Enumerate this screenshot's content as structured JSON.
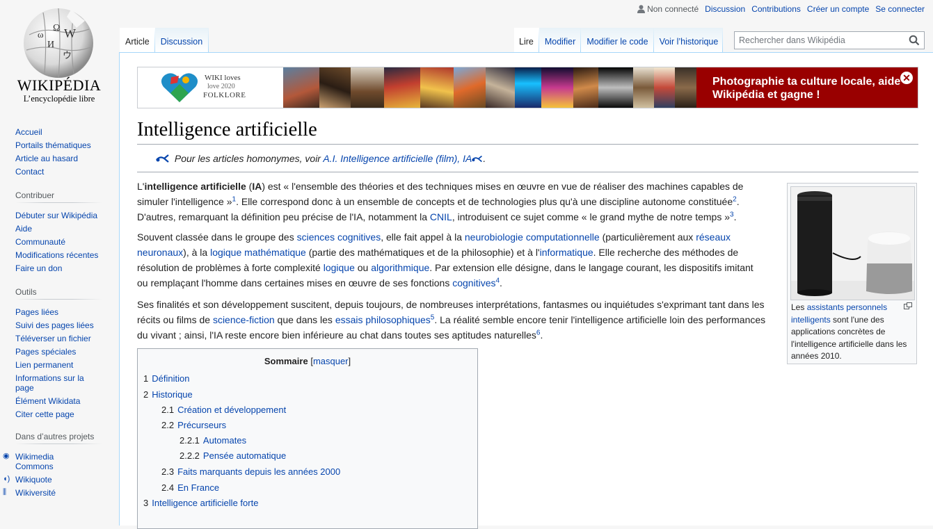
{
  "logo": {
    "wordmark": "WIKIPÉDIA",
    "tagline": "L’encyclopédie libre"
  },
  "sidebar": {
    "nav": [
      "Accueil",
      "Portails thématiques",
      "Article au hasard",
      "Contact"
    ],
    "contribute": {
      "title": "Contribuer",
      "items": [
        "Débuter sur Wikipédia",
        "Aide",
        "Communauté",
        "Modifications récentes",
        "Faire un don"
      ]
    },
    "tools": {
      "title": "Outils",
      "items": [
        "Pages liées",
        "Suivi des pages liées",
        "Téléverser un fichier",
        "Pages spéciales",
        "Lien permanent",
        "Informations sur la page",
        "Élément Wikidata",
        "Citer cette page"
      ]
    },
    "projects": {
      "title": "Dans d’autres projets",
      "items": [
        "Wikimedia Commons",
        "Wikiquote",
        "Wikiversité"
      ]
    }
  },
  "personal": {
    "status": "Non connecté",
    "links": [
      "Discussion",
      "Contributions",
      "Créer un compte",
      "Se connecter"
    ]
  },
  "tabs": {
    "left": [
      "Article",
      "Discussion"
    ],
    "right": [
      "Lire",
      "Modifier",
      "Modifier le code",
      "Voir l’historique"
    ]
  },
  "search": {
    "placeholder": "Rechercher dans Wikipédia"
  },
  "banner": {
    "wl_line1": "WIKI loves",
    "wl_line2": "love 2020",
    "wl_line3": "FOLKLORE",
    "cta_line1": "Photographie ta culture locale, aide",
    "cta_line2": "Wikipédia et gagne !"
  },
  "article": {
    "title": "Intelligence artificielle",
    "hatnote": {
      "prefix": "Pour les articles homonymes, voir",
      "links": "A.I. Intelligence artificielle (film), IA",
      "suffix": "."
    },
    "p1": {
      "a": "L'",
      "b": "intelligence artificielle",
      "c": " (",
      "d": "IA",
      "e": ") est « l'ensemble des théories et des techniques mises en œuvre en vue de réaliser des machines capables de simuler l'intelligence »",
      "r1": "1",
      "f": ". Elle correspond donc à un ensemble de concepts et de technologies plus qu'à une discipline autonome constituée",
      "r2": "2",
      "g": ". D'autres, remarquant la définition peu précise de l'IA, notamment la ",
      "l1": "CNIL",
      "h": ", introduisent ce sujet comme « le grand mythe de notre temps »",
      "r3": "3",
      "i": "."
    },
    "p2": {
      "a": "Souvent classée dans le groupe des ",
      "l1": "sciences cognitives",
      "b": ", elle fait appel à la ",
      "l2": "neurobiologie computationnelle",
      "c": " (particulièrement aux ",
      "l3": "réseaux neuronaux",
      "d": "), à la ",
      "l4": "logique mathématique",
      "e": " (partie des mathématiques et de la philosophie) et à l'",
      "l5": "informatique",
      "f": ". Elle recherche des méthodes de résolution de problèmes à forte complexité ",
      "l6": "logique",
      "g": " ou ",
      "l7": "algorithmique",
      "h": ". Par extension elle désigne, dans le langage courant, les dispositifs imitant ou remplaçant l'homme dans certaines mises en œuvre de ses fonctions ",
      "l8": "cognitives",
      "r4": "4",
      "i": "."
    },
    "p3": {
      "a": "Ses finalités et son développement suscitent, depuis toujours, de nombreuses interprétations, fantasmes ou inquiétudes s'exprimant tant dans les récits ou films de ",
      "l1": "science-fiction",
      "b": " que dans les ",
      "l2": "essais philosophiques",
      "r5": "5",
      "c": ". La réalité semble encore tenir l'intelligence artificielle loin des performances du vivant ; ainsi, l'IA reste encore bien inférieure au chat dans toutes ses aptitudes naturelles",
      "r6": "6",
      "d": "."
    },
    "thumb": {
      "cap_a": "Les ",
      "cap_link": "assistants personnels intelligents",
      "cap_b": " sont l'une des applications concrètes de l'intelligence artificielle dans les années 2010."
    }
  },
  "toc": {
    "title": "Sommaire",
    "toggle_open": "[",
    "toggle": "masquer",
    "toggle_close": "]",
    "items": [
      {
        "num": "1",
        "label": "Définition"
      },
      {
        "num": "2",
        "label": "Historique"
      },
      {
        "num": "2.1",
        "label": "Création et développement"
      },
      {
        "num": "2.2",
        "label": "Précurseurs"
      },
      {
        "num": "2.2.1",
        "label": "Automates"
      },
      {
        "num": "2.2.2",
        "label": "Pensée automatique"
      },
      {
        "num": "2.3",
        "label": "Faits marquants depuis les années 2000"
      },
      {
        "num": "2.4",
        "label": "En France"
      },
      {
        "num": "3",
        "label": "Intelligence artificielle forte"
      }
    ]
  },
  "colors": {
    "link": "#0645ad",
    "banner_red": "#990000",
    "border": "#a7d7f9"
  }
}
